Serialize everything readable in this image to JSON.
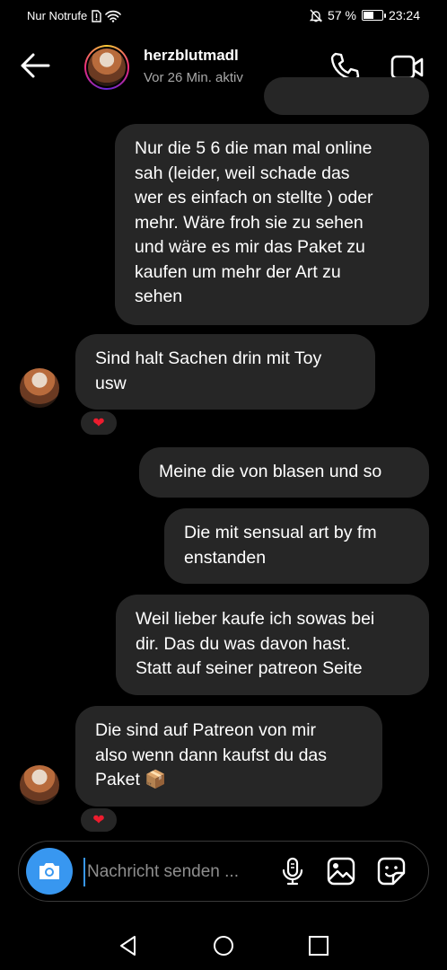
{
  "status_bar": {
    "carrier": "Nur Notrufe",
    "battery": "57 %",
    "time": "23:24",
    "battery_level": 0.57
  },
  "header": {
    "username": "herzblutmadl",
    "activity": "Vor 26 Min. aktiv",
    "icons": [
      "back-arrow-icon",
      "phone-icon",
      "video-camera-icon"
    ]
  },
  "messages": [
    {
      "sender": "me",
      "text": "Nur die 5 6 die man mal online\nsah (leider, weil schade das\nwer es einfach on stellte ) oder\nmehr. Wäre froh sie zu sehen\nund wäre es mir das Paket zu\nkaufen um mehr der Art zu\nsehen"
    },
    {
      "sender": "them",
      "text": "Sind halt Sachen drin mit Toy\nusw",
      "reaction": "❤"
    },
    {
      "sender": "me",
      "text": "Meine die von blasen und so"
    },
    {
      "sender": "me",
      "text": "Die mit sensual art by fm\nenstanden"
    },
    {
      "sender": "me",
      "text": "Weil lieber kaufe ich sowas bei\ndir. Das du was davon hast.\nStatt auf seiner patreon Seite"
    },
    {
      "sender": "them",
      "text": "Die sind auf Patreon von mir\nalso wenn dann kaufst du das\nPaket 📦",
      "reaction": "❤"
    }
  ],
  "composer": {
    "placeholder": "Nachricht senden ...",
    "icons": [
      "camera-icon",
      "microphone-icon",
      "gallery-icon",
      "sticker-icon"
    ]
  },
  "colors": {
    "background": "#000000",
    "bubble": "#262626",
    "camera_button": "#3897f0",
    "heart": "#ed1c2e"
  }
}
